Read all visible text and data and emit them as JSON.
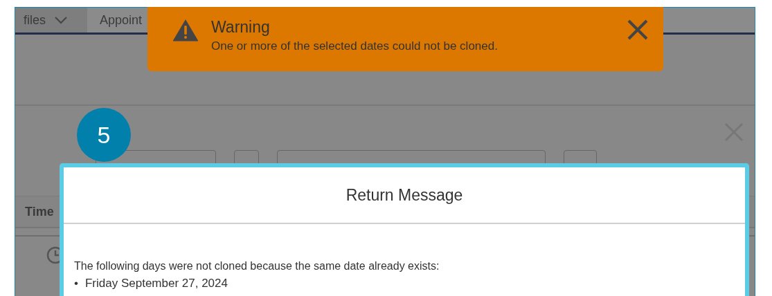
{
  "nav_tabs": [
    {
      "label": "files",
      "selected": true,
      "dropdown": true
    },
    {
      "label": "Appoint",
      "selected": false
    }
  ],
  "table": {
    "columns": [
      {
        "label": "Time"
      }
    ]
  },
  "toast": {
    "kind": "warning",
    "title": "Warning",
    "message": "One or more of the selected dates could not be cloned."
  },
  "step_badge": "5",
  "dialog": {
    "title": "Return Message",
    "message": "The following days were not cloned because the same date already exists:",
    "items": [
      {
        "bullet": "•",
        "text": "Friday September 27, 2024"
      }
    ]
  }
}
